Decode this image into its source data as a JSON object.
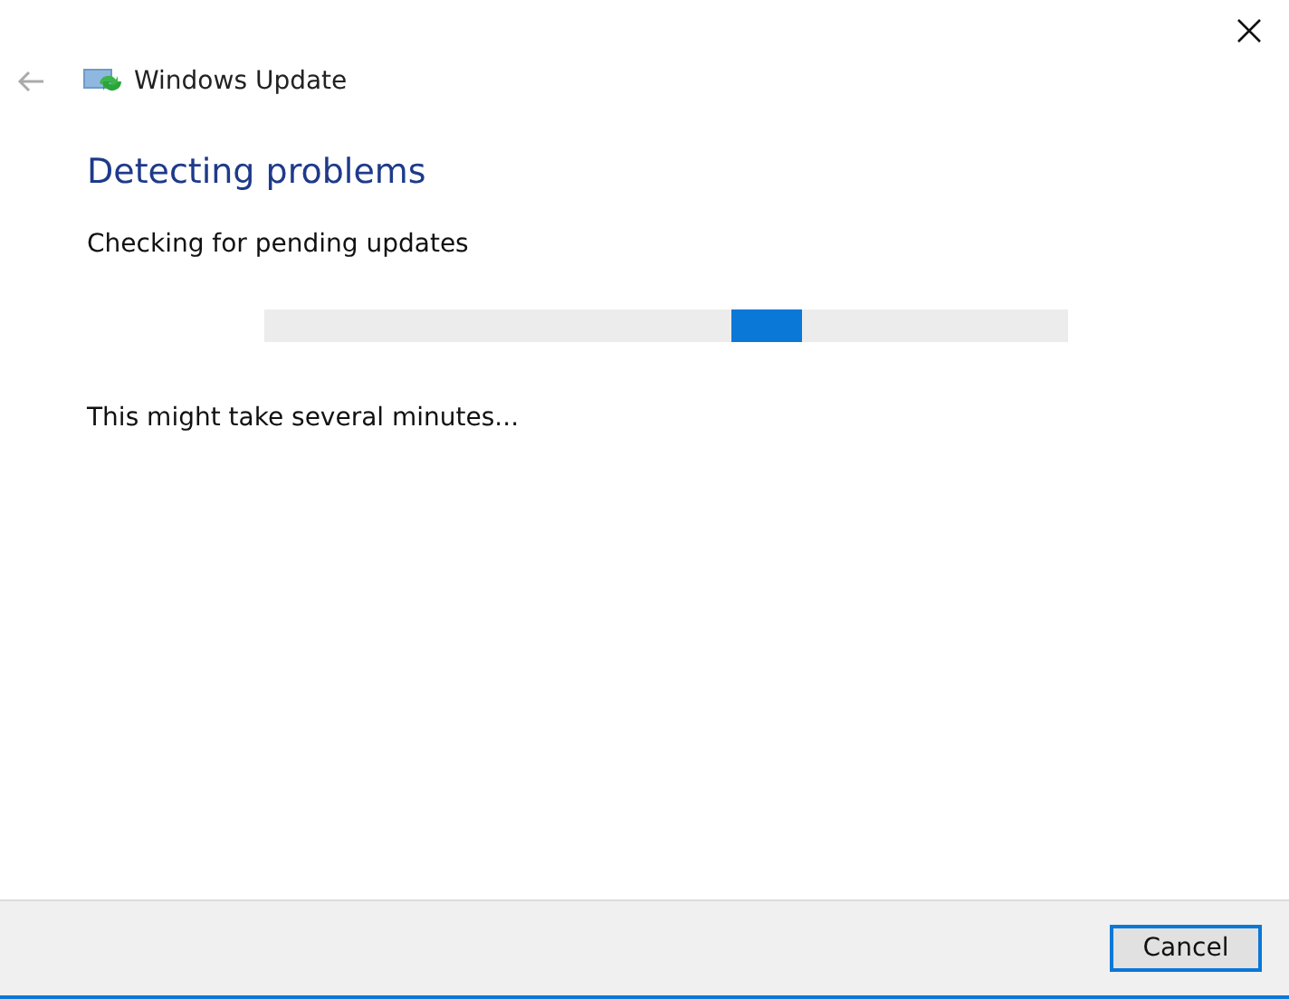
{
  "window": {
    "title": "Windows Update"
  },
  "heading": "Detecting problems",
  "status": "Checking for pending updates",
  "progress": {
    "kind": "indeterminate",
    "level": 0.67
  },
  "note": "This might take several minutes...",
  "buttons": [
    {
      "label": "Cancel",
      "selected": true
    }
  ]
}
